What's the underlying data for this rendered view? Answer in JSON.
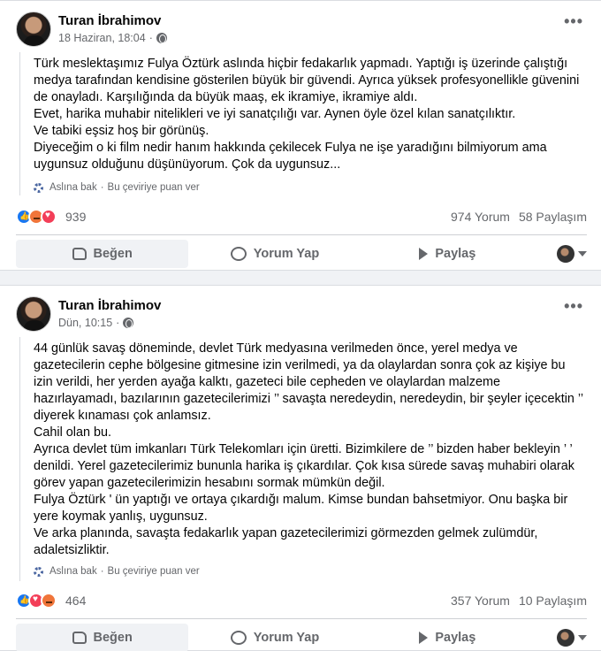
{
  "posts": [
    {
      "author": "Turan İbrahimov",
      "date": "18 Haziran, 18:04",
      "paragraphs": [
        "Türk meslektaşımız Fulya Öztürk aslında hiçbir fedakarlık yapmadı. Yaptığı iş üzerinde çalıştığı medya tarafından kendisine gösterilen büyük bir güvendi. Ayrıca yüksek profesyonellikle güvenini de onayladı. Karşılığında da büyük maaş, ek ikramiye, ikramiye aldı.",
        "Evet, harika muhabir nitelikleri ve iyi sanatçılığı var. Aynen öyle özel kılan sanatçılıktır.",
        "Ve tabiki eşsiz hoş bir görünüş.",
        "Diyeceğim o ki film nedir hanım hakkında çekilecek Fulya ne işe yaradığını bilmiyorum ama uygunsuz olduğunu düşünüyorum. Çok da uygunsuz..."
      ],
      "see_original": "Aslına bak",
      "rate_translation": "Bu çeviriye puan ver",
      "reactions": [
        "like",
        "angry",
        "love"
      ],
      "reaction_count": "939",
      "comments": "974 Yorum",
      "shares": "58 Paylaşım"
    },
    {
      "author": "Turan İbrahimov",
      "date": "Dün, 10:15",
      "paragraphs": [
        "44 günlük savaş döneminde, devlet Türk medyasına verilmeden önce, yerel medya ve gazetecilerin cephe bölgesine gitmesine izin verilmedi, ya da olaylardan sonra çok az kişiye bu izin verildi, her yerden ayağa kalktı, gazeteci bile cepheden ve olaylardan malzeme hazırlayamadı, bazılarının gazetecilerimizi ’’ savaşta neredeydin, neredeydin, bir şeyler içecektin ’’ diyerek kınaması çok anlamsız.",
        "Cahil olan bu.",
        "Ayrıca devlet tüm imkanları Türk Telekomları için üretti. Bizimkilere de ’’ bizden haber bekleyin ’ ’ denildi. Yerel gazetecilerimiz bununla harika iş çıkardılar. Çok kısa sürede savaş muhabiri olarak görev yapan gazetecilerimizin hesabını sormak mümkün değil.",
        "Fulya Öztürk ' ün yaptığı ve ortaya çıkardığı malum. Kimse bundan bahsetmiyor. Onu başka bir yere koymak yanlış, uygunsuz.",
        "Ve arka planında, savaşta fedakarlık yapan gazetecilerimizi görmezden gelmek zulümdür, adaletsizliktir."
      ],
      "see_original": "Aslına bak",
      "rate_translation": "Bu çeviriye puan ver",
      "reactions": [
        "like",
        "love",
        "angry"
      ],
      "reaction_count": "464",
      "comments": "357 Yorum",
      "shares": "10 Paylaşım"
    }
  ],
  "actions": {
    "like": "Beğen",
    "comment": "Yorum Yap",
    "share": "Paylaş"
  },
  "separator": "·"
}
